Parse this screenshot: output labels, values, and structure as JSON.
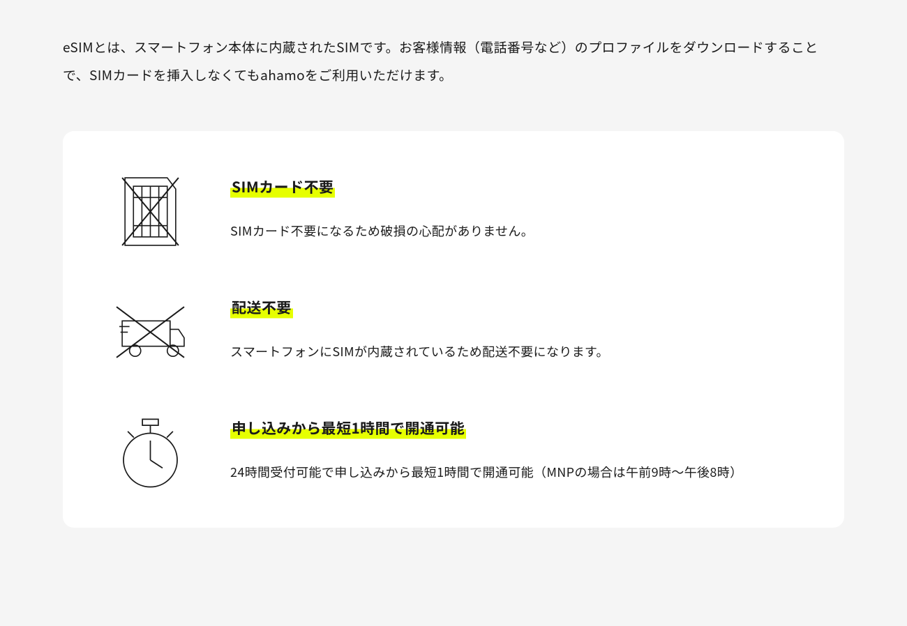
{
  "intro": "eSIMとは、スマートフォン本体に内蔵されたSIMです。お客様情報（電話番号など）のプロファイルをダウンロードすることで、SIMカードを挿入しなくてもahamoをご利用いただけます。",
  "features": [
    {
      "title": "SIMカード不要",
      "description": "SIMカード不要になるため破損の心配がありません。"
    },
    {
      "title": "配送不要",
      "description": "スマートフォンにSIMが内蔵されているため配送不要になります。"
    },
    {
      "title": "申し込みから最短1時間で開通可能",
      "description": "24時間受付可能で申し込みから最短1時間で開通可能（MNPの場合は午前9時〜午後8時）"
    }
  ]
}
